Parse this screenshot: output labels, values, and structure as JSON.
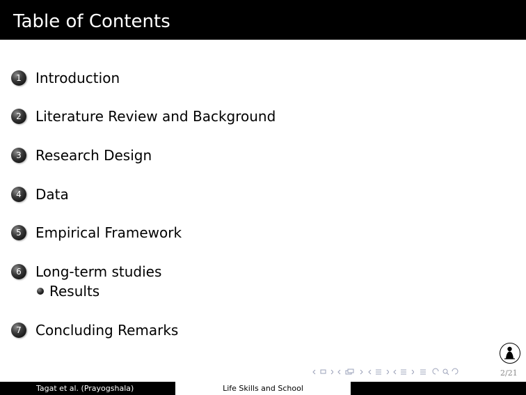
{
  "frame": {
    "title": "Table of Contents"
  },
  "toc": [
    {
      "num": "1",
      "label": "Introduction",
      "subs": []
    },
    {
      "num": "2",
      "label": "Literature Review and Background",
      "subs": []
    },
    {
      "num": "3",
      "label": "Research Design",
      "subs": []
    },
    {
      "num": "4",
      "label": "Data",
      "subs": []
    },
    {
      "num": "5",
      "label": "Empirical Framework",
      "subs": []
    },
    {
      "num": "6",
      "label": "Long-term studies",
      "subs": [
        "Results"
      ]
    },
    {
      "num": "7",
      "label": "Concluding Remarks",
      "subs": []
    }
  ],
  "footer": {
    "left": "Tagat et al.  (Prayogshala)",
    "center": "Life Skills and School",
    "right": ""
  },
  "page": {
    "number": "2/21"
  },
  "icons": {
    "logo": "institution-logo-icon",
    "nav": [
      "nav-frame-prev-icon",
      "nav-frame-next-icon",
      "nav-subsection-icon",
      "nav-section-icon",
      "nav-toc-icon",
      "nav-back-icon",
      "nav-search-icon",
      "nav-forward-icon"
    ]
  }
}
